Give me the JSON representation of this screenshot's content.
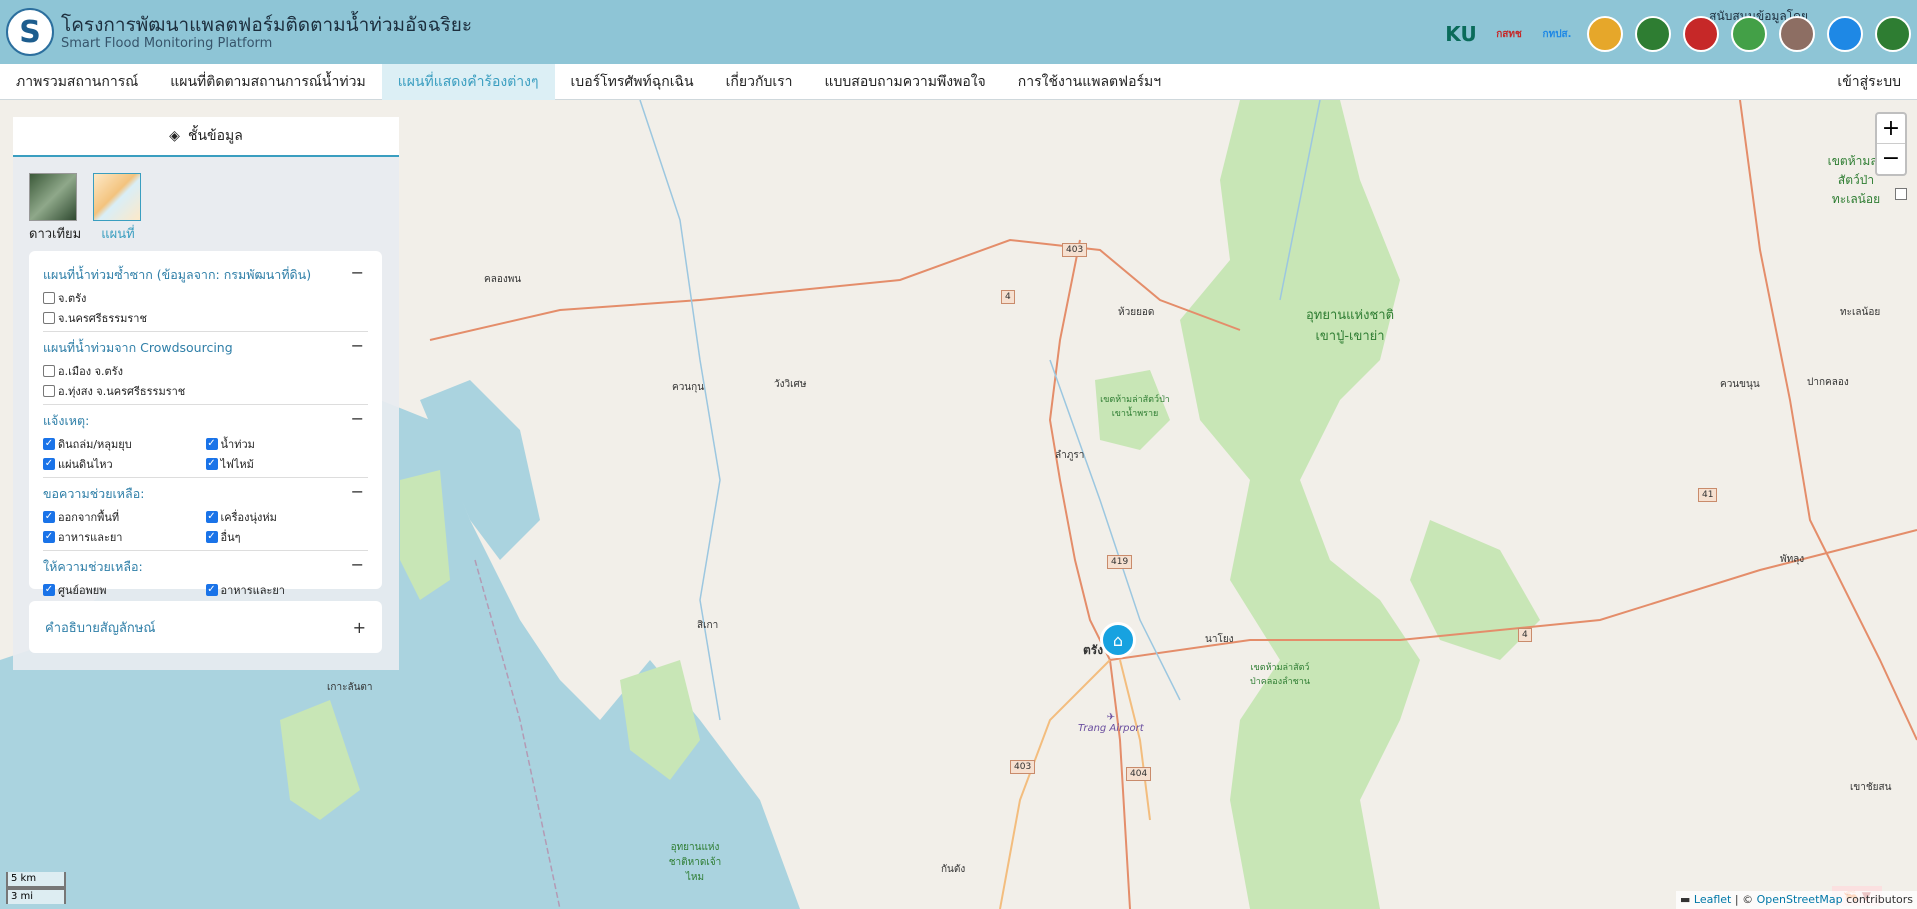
{
  "header": {
    "title_th": "โครงการพัฒนาแพลตฟอร์มติดตามน้ำท่วมอัจฉริยะ",
    "title_en": "Smart Flood Monitoring Platform",
    "partner_label": "สนับสนุนข้อมูลโดย",
    "logos": [
      {
        "name": "ku-logo",
        "text": "KU",
        "color": "#0a6b5a"
      },
      {
        "name": "gistda-logo",
        "text": "กสทช",
        "color": "#c62828"
      },
      {
        "name": "hii-logo",
        "text": "กทปส.",
        "color": "#1e88e5"
      },
      {
        "name": "dept-logo-1",
        "text": "",
        "color": "#e6a72a"
      },
      {
        "name": "dept-logo-2",
        "text": "",
        "color": "#2e7d32"
      },
      {
        "name": "dept-logo-3",
        "text": "",
        "color": "#c62828"
      },
      {
        "name": "dept-logo-4",
        "text": "",
        "color": "#43a047"
      },
      {
        "name": "dept-logo-5",
        "text": "",
        "color": "#8d6e63"
      },
      {
        "name": "dept-logo-6",
        "text": "",
        "color": "#1e88e5"
      },
      {
        "name": "dept-logo-7",
        "text": "",
        "color": "#2e7d32"
      }
    ]
  },
  "nav": {
    "items": [
      "ภาพรวมสถานการณ์",
      "แผนที่ติดตามสถานการณ์น้ำท่วม",
      "แผนที่แสดงคำร้องต่างๆ",
      "เบอร์โทรศัพท์ฉุกเฉิน",
      "เกี่ยวกับเรา",
      "แบบสอบถามความพึงพอใจ",
      "การใช้งานแพลตฟอร์มฯ"
    ],
    "active_index": 2,
    "login": "เข้าสู่ระบบ"
  },
  "panel": {
    "title": "ชั้นข้อมูล",
    "basemaps": [
      {
        "label": "ดาวเทียม",
        "active": false
      },
      {
        "label": "แผนที่",
        "active": true
      }
    ],
    "sections": [
      {
        "title": "แผนที่น้ำท่วมซ้ำซาก (ข้อมูลจาก: กรมพัฒนาที่ดิน)",
        "toggle": "−",
        "cols": 1,
        "options": [
          {
            "label": "จ.ตรัง",
            "checked": false
          },
          {
            "label": "จ.นครศรีธรรมราช",
            "checked": false
          }
        ]
      },
      {
        "title": "แผนที่น้ำท่วมจาก Crowdsourcing",
        "toggle": "−",
        "cols": 1,
        "options": [
          {
            "label": "อ.เมือง จ.ตรัง",
            "checked": false
          },
          {
            "label": "อ.ทุ่งสง จ.นครศรีธรรมราช",
            "checked": false
          }
        ]
      },
      {
        "title": "แจ้งเหตุ:",
        "toggle": "−",
        "cols": 2,
        "options": [
          {
            "label": "ดินถล่ม/หลุมยุบ",
            "checked": true
          },
          {
            "label": "น้ำท่วม",
            "checked": true
          },
          {
            "label": "แผ่นดินไหว",
            "checked": true
          },
          {
            "label": "ไฟไหม้",
            "checked": true
          }
        ]
      },
      {
        "title": "ขอความช่วยเหลือ:",
        "toggle": "−",
        "cols": 2,
        "options": [
          {
            "label": "ออกจากพื้นที่",
            "checked": true
          },
          {
            "label": "เครื่องนุ่งห่ม",
            "checked": true
          },
          {
            "label": "อาหารและยา",
            "checked": true
          },
          {
            "label": "อื่นๆ",
            "checked": true
          }
        ]
      },
      {
        "title": "ให้ความช่วยเหลือ:",
        "toggle": "−",
        "cols": 2,
        "options": [
          {
            "label": "ศูนย์อพยพ",
            "checked": true
          },
          {
            "label": "อาหารและยา",
            "checked": true
          },
          {
            "label": "อื่นๆ",
            "checked": true
          }
        ]
      }
    ],
    "legend": {
      "title": "คำอธิบายสัญลักษณ์",
      "toggle": "+"
    }
  },
  "map": {
    "zoom_in": "+",
    "zoom_out": "−",
    "place_labels": [
      {
        "text": "คลองพน"
      },
      {
        "text": "ห้วยยอด"
      },
      {
        "text": "ควนกุน"
      },
      {
        "text": "วังวิเศษ"
      },
      {
        "text": "ลำภูรา"
      },
      {
        "text": "สิเกา"
      },
      {
        "text": "ตรัง"
      },
      {
        "text": "นาโยง"
      },
      {
        "text": "เกาะลันตา"
      },
      {
        "text": "กันตัง"
      },
      {
        "text": "ทะเลน้อย"
      },
      {
        "text": "ควนขนุน"
      },
      {
        "text": "ปากคลอง"
      },
      {
        "text": "พัทลุง"
      },
      {
        "text": "เขาชัยสน"
      }
    ],
    "park_labels": [
      {
        "text": "อุทยานแห่งชาติเขาปู่-เขาย่า"
      },
      {
        "text": "เขตห้ามล่าสัตว์ป่าเขาน้ำพราย"
      },
      {
        "text": "เขตห้ามล่าสัตว์ป่าคลองลำชาน"
      },
      {
        "text": "อุทยานแห่งชาติหาดเจ้าไหม"
      },
      {
        "text": "เขตห้ามล่าสัตว์ป่าทะเลน้อย"
      }
    ],
    "road_shields": [
      "403",
      "4",
      "41",
      "419",
      "4",
      "403",
      "404"
    ],
    "airport": "Trang Airport",
    "scale": [
      "5 km",
      "3 mi"
    ],
    "attribution": {
      "leaflet": "Leaflet",
      "sep": " | © ",
      "osm": "OpenStreetMap",
      "rest": " contributors"
    },
    "lang": "▼"
  }
}
